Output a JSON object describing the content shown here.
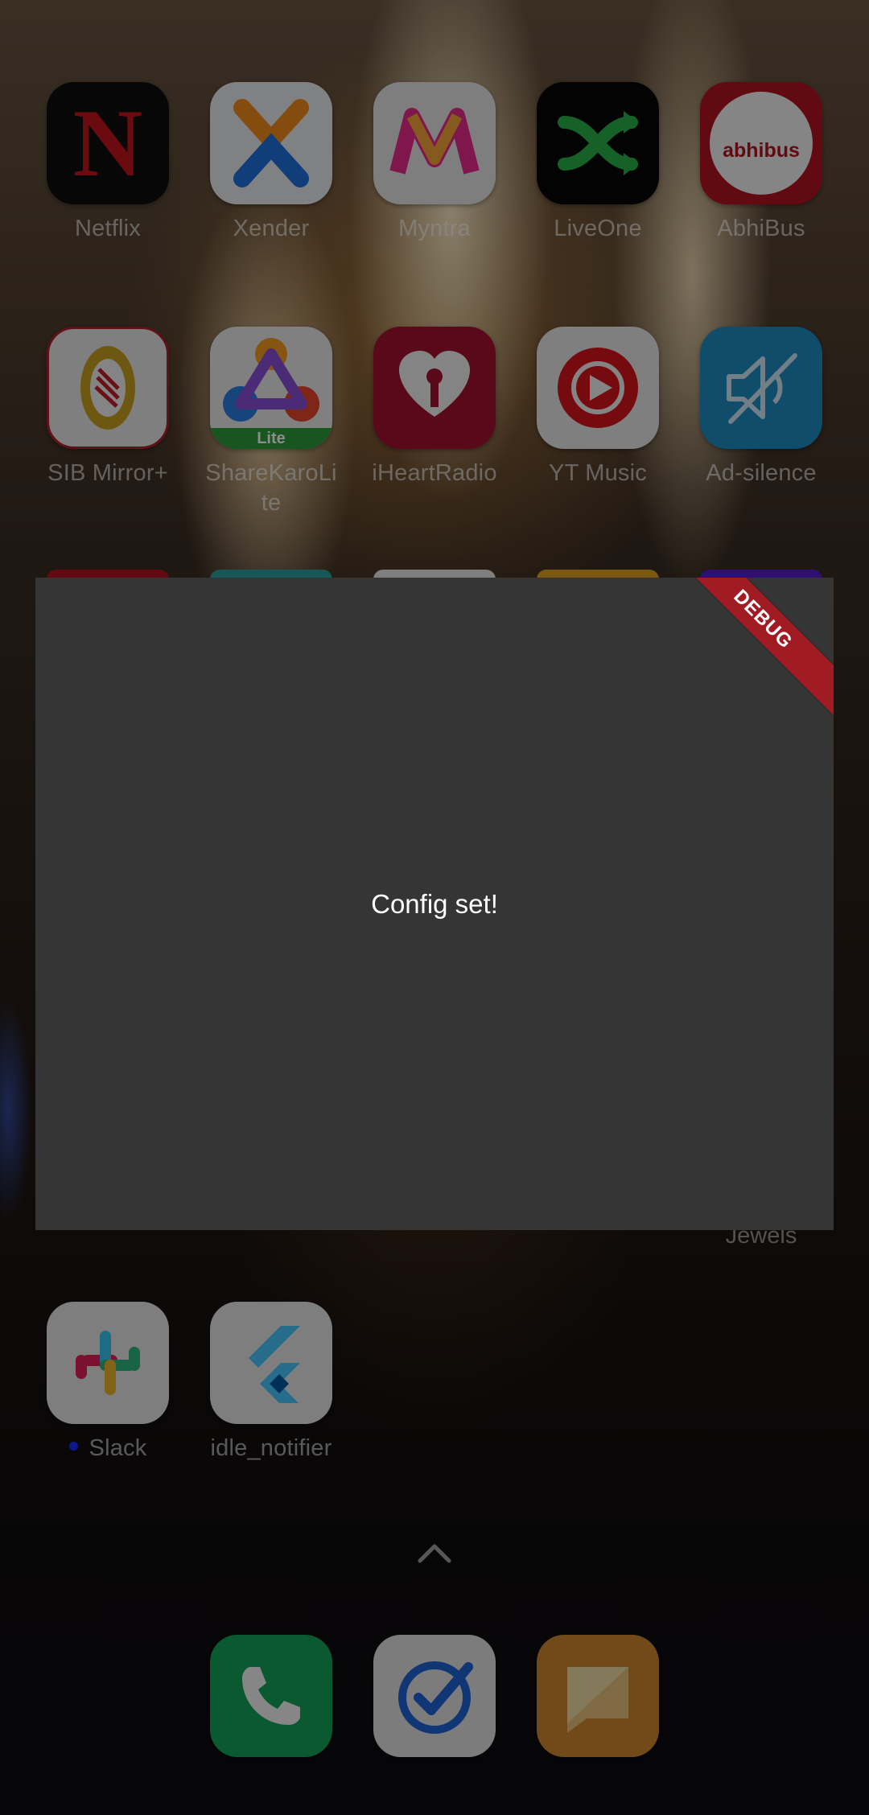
{
  "home": {
    "row1": [
      {
        "label": "Netflix",
        "icon": "netflix-icon"
      },
      {
        "label": "Xender",
        "icon": "xender-icon"
      },
      {
        "label": "Myntra",
        "icon": "myntra-icon"
      },
      {
        "label": "LiveOne",
        "icon": "liveone-icon"
      },
      {
        "label": "AbhiBus",
        "icon": "abhibus-icon",
        "icon_text": "abhibus"
      }
    ],
    "row2": [
      {
        "label": "SIB Mirror+",
        "icon": "sib-mirror-icon"
      },
      {
        "label": "ShareKaroLi\nte",
        "icon": "sharekaro-lite-icon",
        "badge": "Lite"
      },
      {
        "label": "iHeartRadio",
        "icon": "iheartradio-icon"
      },
      {
        "label": "YT Music",
        "icon": "yt-music-icon"
      },
      {
        "label": "Ad-silence",
        "icon": "ad-silence-icon"
      }
    ],
    "hidden_row_label": "Jewels",
    "row4": [
      {
        "label": "Slack",
        "icon": "slack-icon",
        "has_notification": true
      },
      {
        "label": "idle_notifier",
        "icon": "flutter-icon"
      }
    ],
    "dock": [
      {
        "icon": "phone-icon"
      },
      {
        "icon": "task-check-icon"
      },
      {
        "icon": "messages-icon"
      }
    ]
  },
  "dialog": {
    "message": "Config set!",
    "debug_banner": "DEBUG"
  },
  "colors": {
    "dialog_bg": "#353535",
    "debug_banner": "#a01c22",
    "label_text": "#ffffff"
  }
}
